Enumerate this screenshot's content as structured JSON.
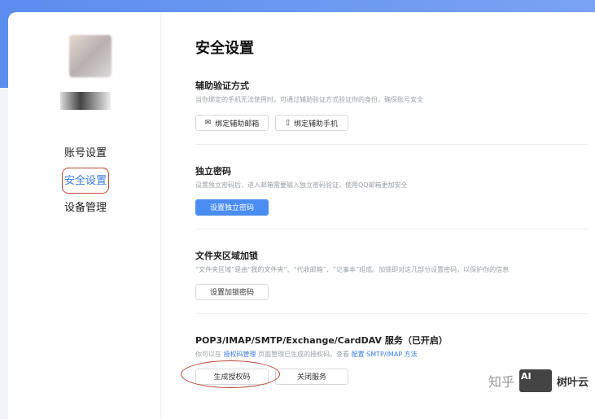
{
  "sidebar": {
    "items": [
      {
        "label": "账号设置"
      },
      {
        "label": "安全设置",
        "active": true
      },
      {
        "label": "设备管理"
      }
    ]
  },
  "page_title": "安全设置",
  "sections": {
    "aux": {
      "title": "辅助验证方式",
      "desc": "当你绑定的手机无法使用时，可通过辅助验证方式验证你的身份，确保账号安全",
      "btn_email": "绑定辅助邮箱",
      "btn_phone": "绑定辅助手机"
    },
    "pwd": {
      "title": "独立密码",
      "desc": "设置独立密码后，进入邮箱需要输入独立密码验证，使用QQ邮箱更加安全",
      "btn": "设置独立密码"
    },
    "lock": {
      "title": "文件夹区域加锁",
      "desc": "“文件夹区域”是由“我的文件夹”、“代收邮箱”、“记事本”组成。加锁即对这几部分设置密码，以保护你的信息",
      "btn": "设置加锁密码"
    },
    "pop": {
      "title": "POP3/IMAP/SMTP/Exchange/CardDAV 服务（已开启）",
      "desc_1": "你可以在 ",
      "link_1": "授权码管理",
      "desc_2": " 页面管理已生成的授权码。查看 ",
      "link_2": "配置 SMTP/IMAP 方法",
      "btn_gen": "生成授权码",
      "btn_close": "关闭服务"
    }
  },
  "watermark": {
    "zhihu": "知乎",
    "ai": "AI",
    "brand": "树叶云"
  }
}
